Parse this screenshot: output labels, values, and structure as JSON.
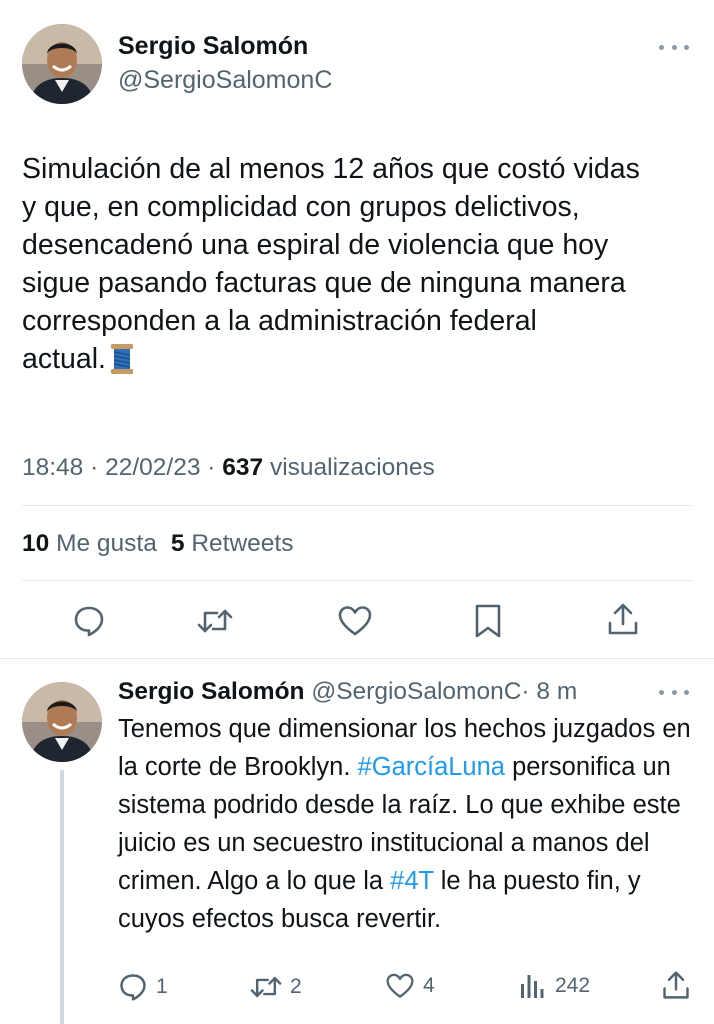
{
  "tweet": {
    "author_name": "Sergio Salomón",
    "author_handle": "@SergioSalomonC",
    "text_before_emoji": "Simulación de al menos 12 años que costó vidas\ny que, en complicidad con grupos delictivos,\ndesencadenó una espiral de violencia que hoy\nsigue pasando facturas que de ninguna manera\ncorresponden a la administración federal\nactual.",
    "emoji": "spool-of-thread",
    "time": "18:48",
    "date": "22/02/23",
    "separator": "·",
    "views_count": "637",
    "views_label": "visualizaciones",
    "likes_count": "10",
    "likes_label": "Me gusta",
    "retweets_count": "5",
    "retweets_label": "Retweets",
    "actions": [
      "reply-icon",
      "retweet-icon",
      "heart-icon",
      "bookmark-icon",
      "share-icon"
    ]
  },
  "reply": {
    "author_name": "Sergio Salomón",
    "author_handle": "@SergioSalomonC",
    "time_ago": "· 8 m",
    "text_part1": "Tenemos que dimensionar los hechos juzgados en la corte de Brooklyn. ",
    "hashtag1": "#GarcíaLuna",
    "text_part2": " personifica un sistema podrido desde la raíz. Lo que exhibe este juicio es un secuestro institucional a manos del crimen. Algo a lo que la ",
    "hashtag2": "#4T",
    "text_part3": " le ha puesto fin, y cuyos efectos busca revertir.",
    "replies": "1",
    "retweets": "2",
    "likes": "4",
    "views": "242"
  },
  "colors": {
    "text": "#0f1419",
    "secondary": "#536471",
    "hashtag": "#1d9bf0",
    "divider": "#e6e9ec"
  }
}
